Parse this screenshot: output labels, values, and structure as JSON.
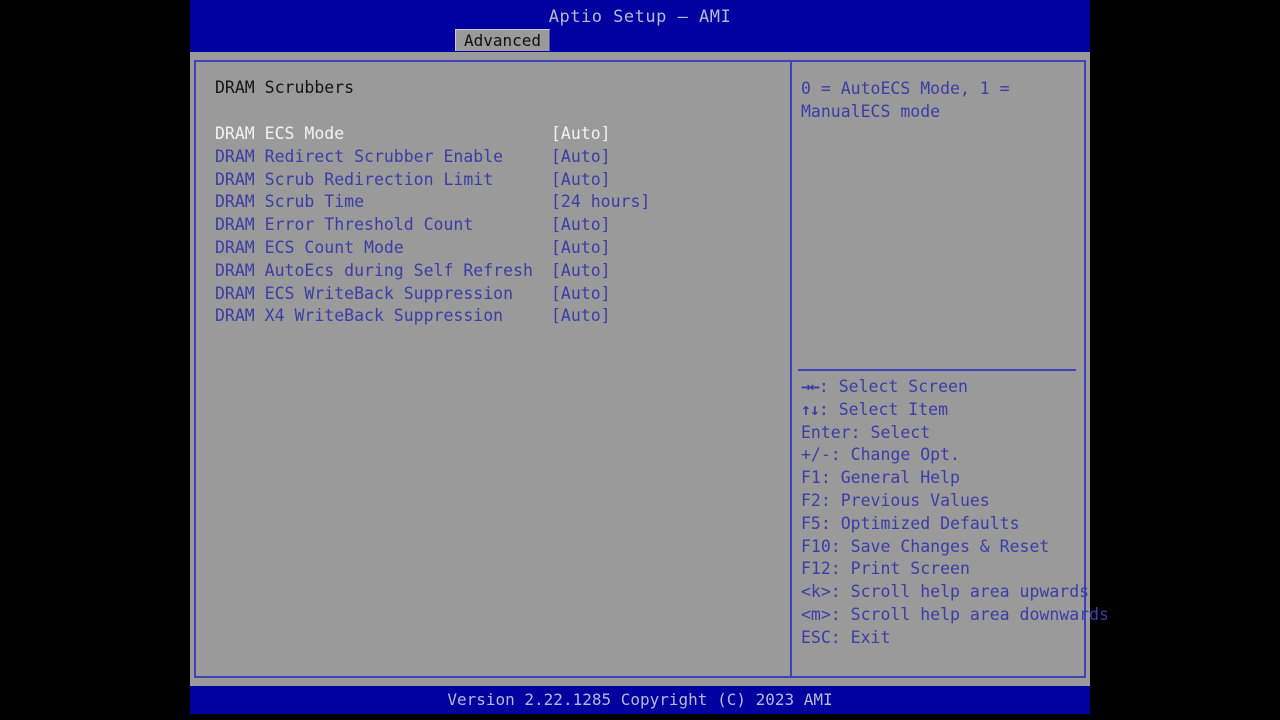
{
  "colors": {
    "title_bar_bg": "#0000a0",
    "console_bg": "#9a9a9a",
    "frame_border": "#4040b8",
    "item_text": "#3c3ca8",
    "selected_text": "#f2f2f2",
    "header_text": "#141414",
    "footer_bg": "#0000a0",
    "footer_text": "#b8b8d8"
  },
  "header": {
    "title": "Aptio Setup – AMI",
    "tabs": [
      {
        "label": "Advanced",
        "active": true
      }
    ]
  },
  "main": {
    "section_title": "DRAM Scrubbers",
    "items": [
      {
        "label": "DRAM ECS Mode",
        "value": "[Auto]",
        "selected": true
      },
      {
        "label": "DRAM Redirect Scrubber Enable",
        "value": "[Auto]",
        "selected": false
      },
      {
        "label": "DRAM Scrub Redirection Limit",
        "value": "[Auto]",
        "selected": false
      },
      {
        "label": "DRAM Scrub Time",
        "value": "[24 hours]",
        "selected": false
      },
      {
        "label": "DRAM Error Threshold Count",
        "value": "[Auto]",
        "selected": false
      },
      {
        "label": "DRAM ECS Count Mode",
        "value": "[Auto]",
        "selected": false
      },
      {
        "label": "DRAM AutoEcs during Self Refresh",
        "value": "[Auto]",
        "selected": false
      },
      {
        "label": "DRAM ECS WriteBack Suppression",
        "value": "[Auto]",
        "selected": false
      },
      {
        "label": "DRAM X4 WriteBack Suppression",
        "value": "[Auto]",
        "selected": false
      }
    ]
  },
  "help": {
    "text": "0 = AutoECS Mode, 1 =\nManualECS mode",
    "key_legend": [
      {
        "glyph": "→←",
        "text": ": Select Screen"
      },
      {
        "glyph": "↑↓",
        "text": ": Select Item"
      },
      {
        "glyph": "",
        "text": "Enter: Select"
      },
      {
        "glyph": "",
        "text": "+/-: Change Opt."
      },
      {
        "glyph": "",
        "text": "F1: General Help"
      },
      {
        "glyph": "",
        "text": "F2: Previous Values"
      },
      {
        "glyph": "",
        "text": "F5: Optimized Defaults"
      },
      {
        "glyph": "",
        "text": "F10: Save Changes & Reset"
      },
      {
        "glyph": "",
        "text": "F12: Print Screen"
      },
      {
        "glyph": "",
        "text": "<k>: Scroll help area upwards"
      },
      {
        "glyph": "",
        "text": "<m>: Scroll help area downwards"
      },
      {
        "glyph": "",
        "text": "ESC: Exit"
      }
    ]
  },
  "footer": {
    "version_text": "Version 2.22.1285 Copyright (C) 2023 AMI"
  }
}
